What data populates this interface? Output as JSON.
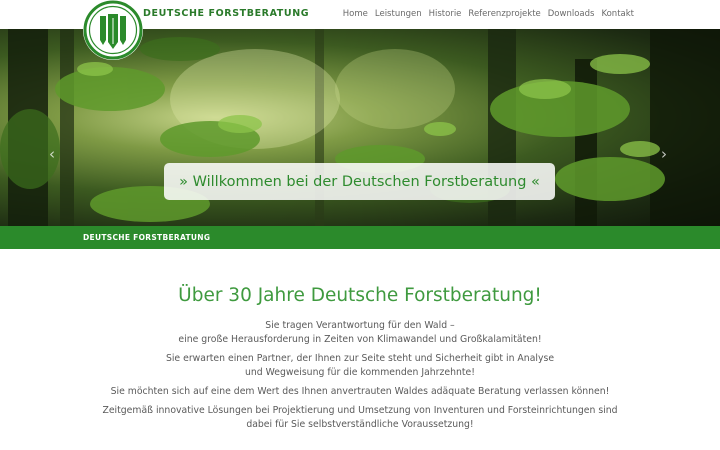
{
  "header": {
    "brand": "DEUTSCHE FORSTBERATUNG",
    "nav": [
      "Home",
      "Leistungen",
      "Historie",
      "Referenzprojekte",
      "Downloads",
      "Kontakt"
    ]
  },
  "hero": {
    "welcome": "» Willkommen bei der Deutschen Forstberatung «",
    "arrow_left": "‹",
    "arrow_right": "›"
  },
  "band": {
    "label": "DEUTSCHE FORSTBERATUNG"
  },
  "main": {
    "headline": "Über 30 Jahre Deutsche Forstberatung!",
    "paragraphs": [
      [
        "Sie tragen Verantwortung für den Wald –",
        "eine große Herausforderung in Zeiten von Klimawandel und Großkalamitäten!"
      ],
      [
        "Sie erwarten einen Partner, der Ihnen zur Seite steht und Sicherheit gibt in Analyse",
        "und Wegweisung für die kommenden Jahrzehnte!"
      ],
      [
        "Sie möchten sich auf eine dem Wert des Ihnen anvertrauten Waldes adäquate Beratung verlassen können!"
      ],
      [
        "Zeitgemäß innovative Lösungen bei Projektierung und Umsetzung von Inventuren und Forsteinrichtungen sind",
        "dabei für Sie selbstverständliche Voraussetzung!"
      ]
    ]
  },
  "colors": {
    "brand_green": "#2b8a2b",
    "headline_green": "#3f9a3f",
    "text_gray": "#5a5a5a",
    "nav_gray": "#6a6a6a"
  },
  "icons": {
    "logo": "forest-logo-icon",
    "slider_left": "chevron-left-icon",
    "slider_right": "chevron-right-icon"
  }
}
